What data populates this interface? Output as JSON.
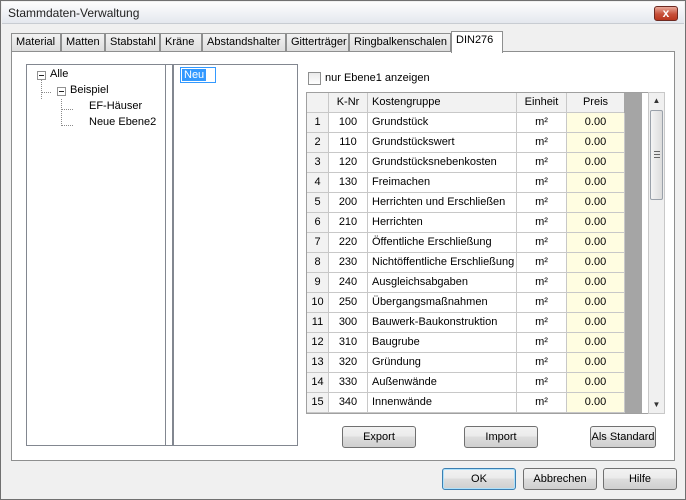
{
  "window": {
    "title": "Stammdaten-Verwaltung",
    "close_label": "x"
  },
  "tabs": [
    {
      "label": "Material"
    },
    {
      "label": "Matten"
    },
    {
      "label": "Stabstahl"
    },
    {
      "label": "Kräne"
    },
    {
      "label": "Abstandshalter"
    },
    {
      "label": "Gitterträger"
    },
    {
      "label": "Ringbalkenschalen"
    },
    {
      "label": "DIN276"
    }
  ],
  "active_tab": "DIN276",
  "tree": {
    "root": "Alle",
    "child": "Beispiel",
    "leaves": [
      "EF-Häuser",
      "Neue Ebene2"
    ]
  },
  "list": {
    "editing_value": "Neu"
  },
  "checkbox": {
    "label": "nur Ebene1 anzeigen",
    "checked": false
  },
  "grid": {
    "headers": {
      "row": "",
      "knr": "K-Nr",
      "kostengruppe": "Kostengruppe",
      "einheit": "Einheit",
      "preis": "Preis"
    },
    "rows": [
      {
        "n": "1",
        "knr": "100",
        "name": "Grundstück",
        "unit": "m²",
        "price": "0.00"
      },
      {
        "n": "2",
        "knr": "110",
        "name": "Grundstückswert",
        "unit": "m²",
        "price": "0.00"
      },
      {
        "n": "3",
        "knr": "120",
        "name": "Grundstücksnebenkosten",
        "unit": "m²",
        "price": "0.00"
      },
      {
        "n": "4",
        "knr": "130",
        "name": "Freimachen",
        "unit": "m²",
        "price": "0.00"
      },
      {
        "n": "5",
        "knr": "200",
        "name": "Herrichten und Erschließen",
        "unit": "m²",
        "price": "0.00"
      },
      {
        "n": "6",
        "knr": "210",
        "name": "Herrichten",
        "unit": "m²",
        "price": "0.00"
      },
      {
        "n": "7",
        "knr": "220",
        "name": "Öffentliche Erschließung",
        "unit": "m²",
        "price": "0.00"
      },
      {
        "n": "8",
        "knr": "230",
        "name": "Nichtöffentliche Erschließung",
        "unit": "m²",
        "price": "0.00"
      },
      {
        "n": "9",
        "knr": "240",
        "name": "Ausgleichsabgaben",
        "unit": "m²",
        "price": "0.00"
      },
      {
        "n": "10",
        "knr": "250",
        "name": "Übergangsmaßnahmen",
        "unit": "m²",
        "price": "0.00"
      },
      {
        "n": "11",
        "knr": "300",
        "name": "Bauwerk-Baukonstruktion",
        "unit": "m²",
        "price": "0.00"
      },
      {
        "n": "12",
        "knr": "310",
        "name": "Baugrube",
        "unit": "m²",
        "price": "0.00"
      },
      {
        "n": "13",
        "knr": "320",
        "name": "Gründung",
        "unit": "m²",
        "price": "0.00"
      },
      {
        "n": "14",
        "knr": "330",
        "name": "Außenwände",
        "unit": "m²",
        "price": "0.00"
      },
      {
        "n": "15",
        "knr": "340",
        "name": "Innenwände",
        "unit": "m²",
        "price": "0.00"
      }
    ]
  },
  "panel_buttons": {
    "export": "Export",
    "import": "Import",
    "standard": "Als Standard"
  },
  "dialog_buttons": {
    "ok": "OK",
    "cancel": "Abbrechen",
    "help": "Hilfe"
  },
  "icons": {
    "close": "close-icon",
    "scroll_up": "chevron-up-icon",
    "scroll_down": "chevron-down-icon",
    "scroll_grip": "grip-icon"
  }
}
